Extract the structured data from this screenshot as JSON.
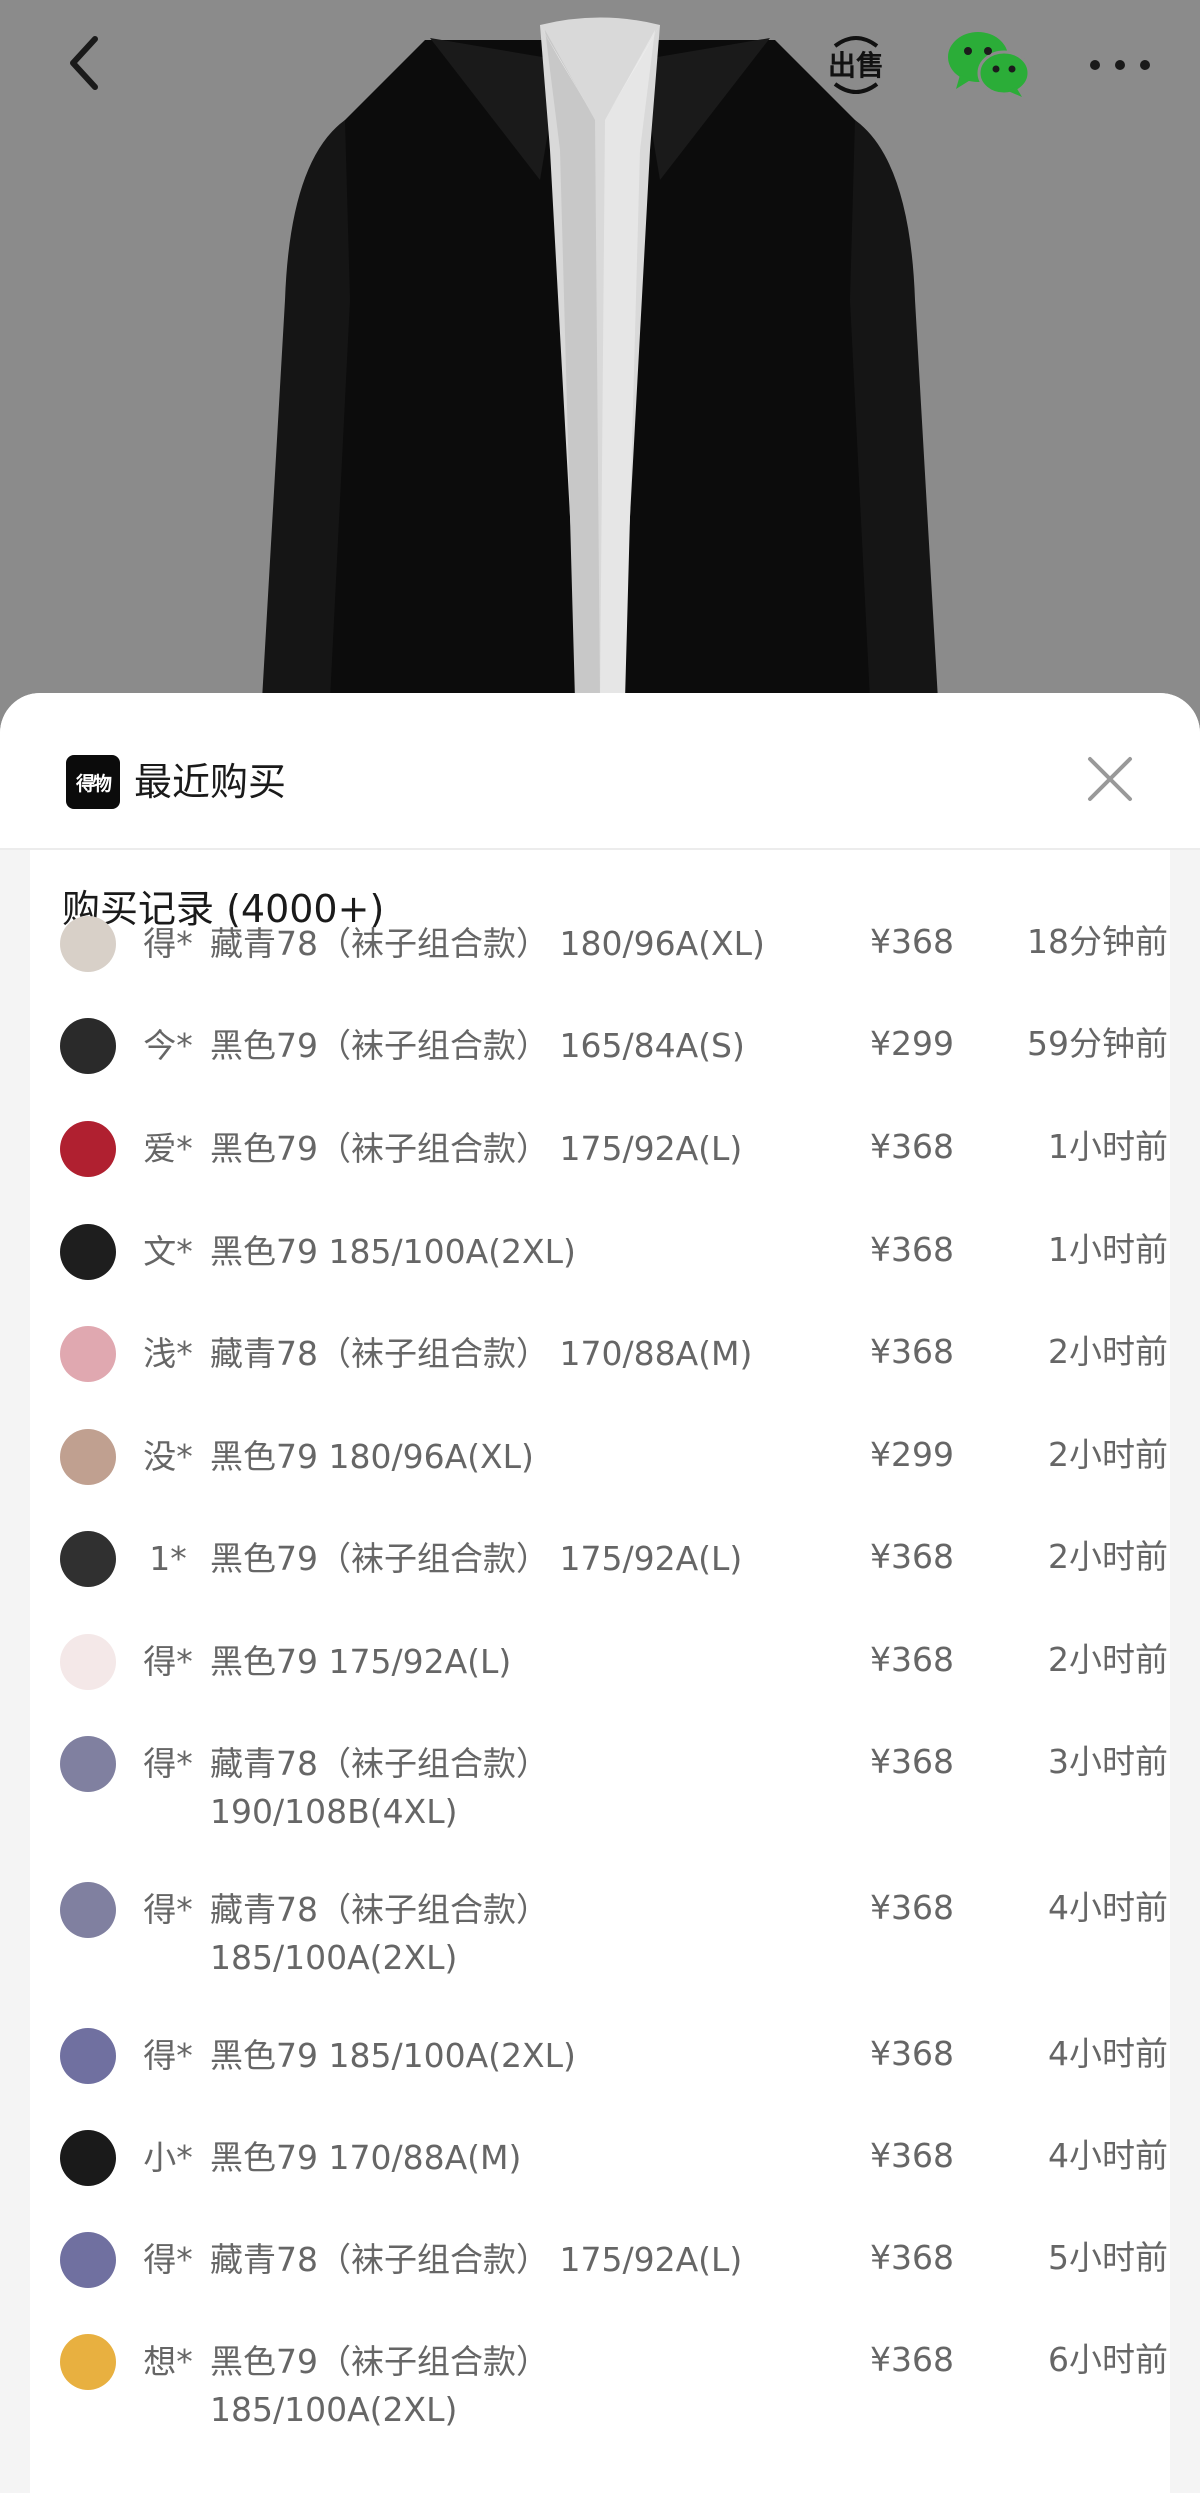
{
  "header": {
    "sell_label": "出售"
  },
  "sheet": {
    "logo_text": "得物",
    "title": "最近购买",
    "records_title": "购买记录 (4000+)"
  },
  "records": [
    {
      "user": "得*",
      "product": "藏青78（袜子组合款） 180/96A(XL)",
      "price": "¥368",
      "time": "18分钟前"
    },
    {
      "user": "今*",
      "product": "黑色79（袜子组合款） 165/84A(S)",
      "price": "¥299",
      "time": "59分钟前"
    },
    {
      "user": "爱*",
      "product": "黑色79（袜子组合款） 175/92A(L)",
      "price": "¥368",
      "time": "1小时前"
    },
    {
      "user": "文*",
      "product": "黑色79 185/100A(2XL)",
      "price": "¥368",
      "time": "1小时前"
    },
    {
      "user": "浅*",
      "product": "藏青78（袜子组合款） 170/88A(M)",
      "price": "¥368",
      "time": "2小时前"
    },
    {
      "user": "没*",
      "product": "黑色79 180/96A(XL)",
      "price": "¥299",
      "time": "2小时前"
    },
    {
      "user": "1*",
      "product": "黑色79（袜子组合款） 175/92A(L)",
      "price": "¥368",
      "time": "2小时前"
    },
    {
      "user": "得*",
      "product": "黑色79 175/92A(L)",
      "price": "¥368",
      "time": "2小时前"
    },
    {
      "user": "得*",
      "product": "藏青78（袜子组合款）\n190/108B(4XL)",
      "price": "¥368",
      "time": "3小时前"
    },
    {
      "user": "得*",
      "product": "藏青78（袜子组合款）\n185/100A(2XL)",
      "price": "¥368",
      "time": "4小时前"
    },
    {
      "user": "得*",
      "product": "黑色79 185/100A(2XL)",
      "price": "¥368",
      "time": "4小时前"
    },
    {
      "user": "小*",
      "product": "黑色79 170/88A(M)",
      "price": "¥368",
      "time": "4小时前"
    },
    {
      "user": "得*",
      "product": "藏青78（袜子组合款） 175/92A(L)",
      "price": "¥368",
      "time": "5小时前"
    },
    {
      "user": "想*",
      "product": "黑色79（袜子组合款）\n185/100A(2XL)",
      "price": "¥368",
      "time": "6小时前"
    }
  ]
}
